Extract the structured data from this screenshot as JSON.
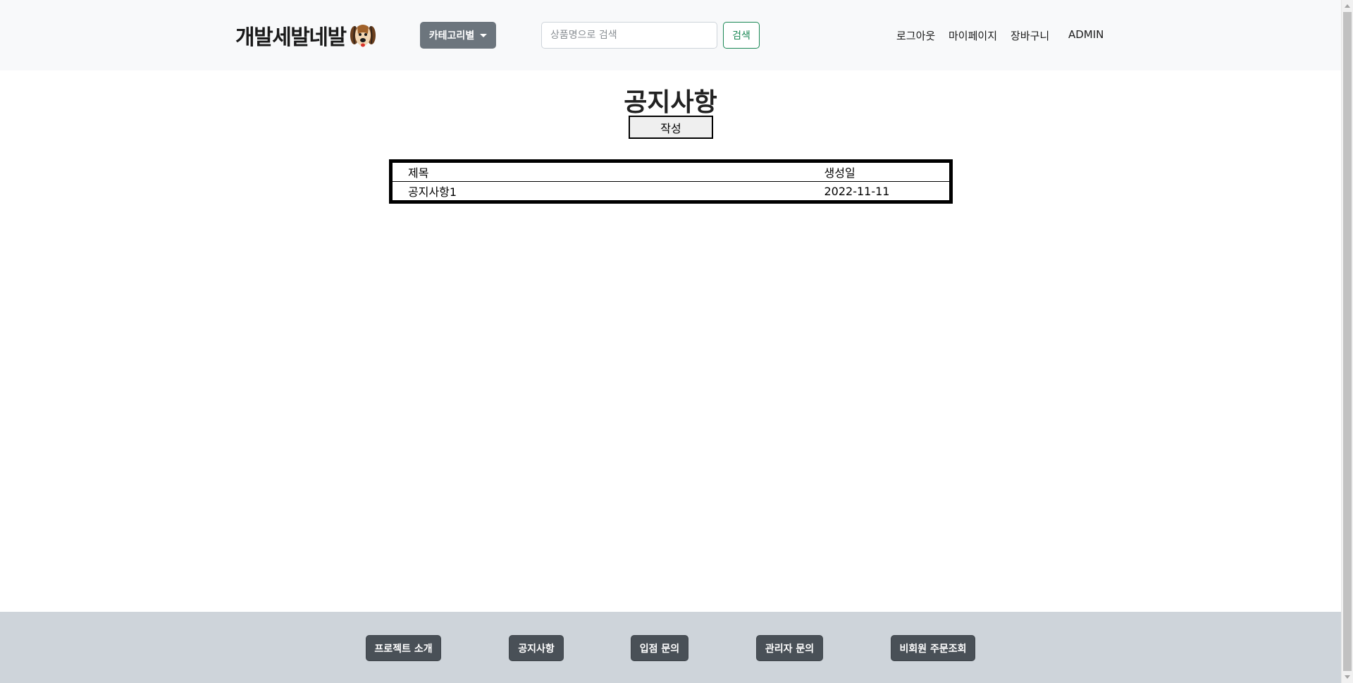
{
  "header": {
    "logo_text": "개발세발네발",
    "category_button": "카테고리별",
    "search": {
      "placeholder": "상품명으로 검색",
      "value": ""
    },
    "search_button": "검색",
    "nav": {
      "logout": "로그아웃",
      "mypage": "마이페이지",
      "cart": "장바구니",
      "admin": "ADMIN"
    }
  },
  "main": {
    "title": "공지사항",
    "write_button": "작성",
    "table": {
      "columns": [
        "제목",
        "생성일"
      ],
      "rows": [
        {
          "title": "공지사항1",
          "created": "2022-11-11"
        }
      ]
    }
  },
  "footer": {
    "buttons": [
      "프로젝트 소개",
      "공지사항",
      "입점 문의",
      "관리자 문의",
      "비회원 주문조회"
    ]
  },
  "colors": {
    "header_bg": "#f8f9fa",
    "category_button": "#6c757d",
    "search_button": "#198754",
    "footer_bg": "#ced4da",
    "footer_button": "#495057"
  }
}
